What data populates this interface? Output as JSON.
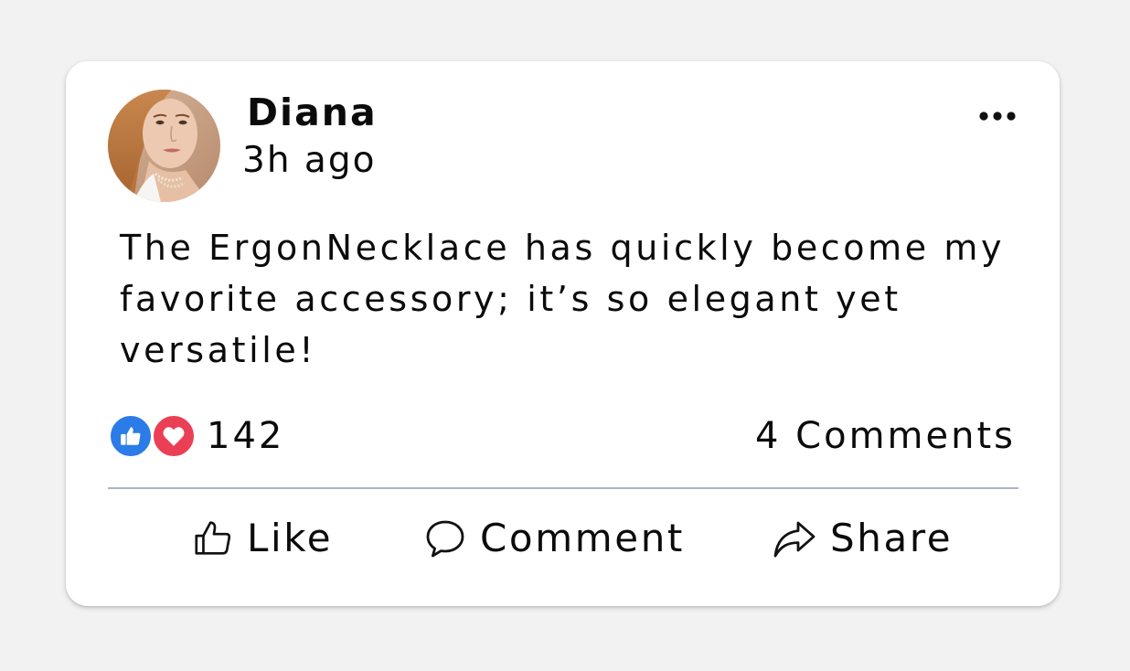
{
  "post": {
    "author": {
      "name": "Diana",
      "avatar_icon": "user-photo-avatar"
    },
    "timestamp": "3h ago",
    "more_icon": "more-horizontal-icon",
    "text": "The ErgonNecklace has quickly become my favorite accessory; it’s so elegant yet versatile!",
    "reactions": {
      "icons": [
        "thumbs-up-icon",
        "heart-icon"
      ],
      "count": "142"
    },
    "comments_count": "4 Comments",
    "actions": {
      "like_label": "Like",
      "comment_label": "Comment",
      "share_label": "Share"
    }
  },
  "colors": {
    "background": "#f2f2f2",
    "card": "#ffffff",
    "like_blue": "#2b7be8",
    "love_red": "#ea3f55",
    "divider": "#aeb6bf",
    "text": "#0b0b0b"
  }
}
